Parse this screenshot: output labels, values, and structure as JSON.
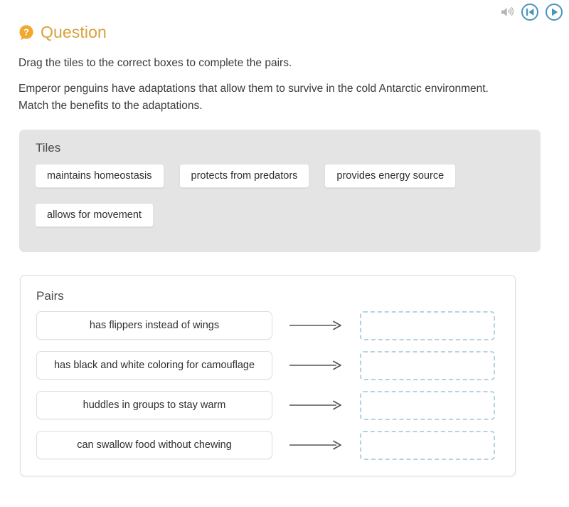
{
  "media_controls": [
    {
      "name": "volume-icon",
      "label": "Volume",
      "color": "#b4b4b4"
    },
    {
      "name": "rewind-button",
      "label": "Restart",
      "color": "#4a93bf"
    },
    {
      "name": "play-button",
      "label": "Play",
      "color": "#4a93bf"
    }
  ],
  "header": {
    "title": "Question",
    "title_color": "#d9a13c",
    "badge_icon": "question-mark-icon",
    "badge_color": "#f0a830"
  },
  "instructions": {
    "line1": "Drag the tiles to the correct boxes to complete the pairs.",
    "line2": "Emperor penguins have adaptations that allow them to survive in the cold Antarctic environment. Match the benefits to the adaptations."
  },
  "tiles_section": {
    "heading": "Tiles",
    "background": "#e4e4e4",
    "tiles": [
      {
        "label": "maintains homeostasis"
      },
      {
        "label": "protects from predators"
      },
      {
        "label": "provides energy source"
      },
      {
        "label": "allows for movement"
      }
    ]
  },
  "pairs_section": {
    "heading": "Pairs",
    "drop_border_color": "#b4d2e0",
    "arrow_color": "#555555",
    "rows": [
      {
        "prompt": "has flippers instead of wings",
        "answer": ""
      },
      {
        "prompt": "has black and white coloring for camouflage",
        "answer": ""
      },
      {
        "prompt": "huddles in groups to stay warm",
        "answer": ""
      },
      {
        "prompt": "can swallow food without chewing",
        "answer": ""
      }
    ]
  }
}
